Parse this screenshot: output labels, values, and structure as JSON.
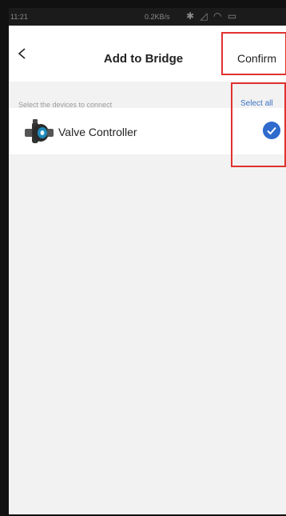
{
  "status_bar": {
    "time": "11:21",
    "speed": "0.2KB/s",
    "icons": [
      "bluetooth-icon",
      "signal-icon",
      "wifi-icon",
      "battery-icon"
    ]
  },
  "nav": {
    "title": "Add to Bridge",
    "confirm_label": "Confirm",
    "back_icon": "chevron-left-icon"
  },
  "section": {
    "label": "Select the devices to connect",
    "select_all_label": "Select all"
  },
  "devices": [
    {
      "name": "Valve Controller",
      "icon": "valve-controller-icon",
      "selected": true
    }
  ],
  "colors": {
    "accent": "#2f6bcd",
    "highlight": "#e0322f",
    "background": "#f2f2f2"
  }
}
